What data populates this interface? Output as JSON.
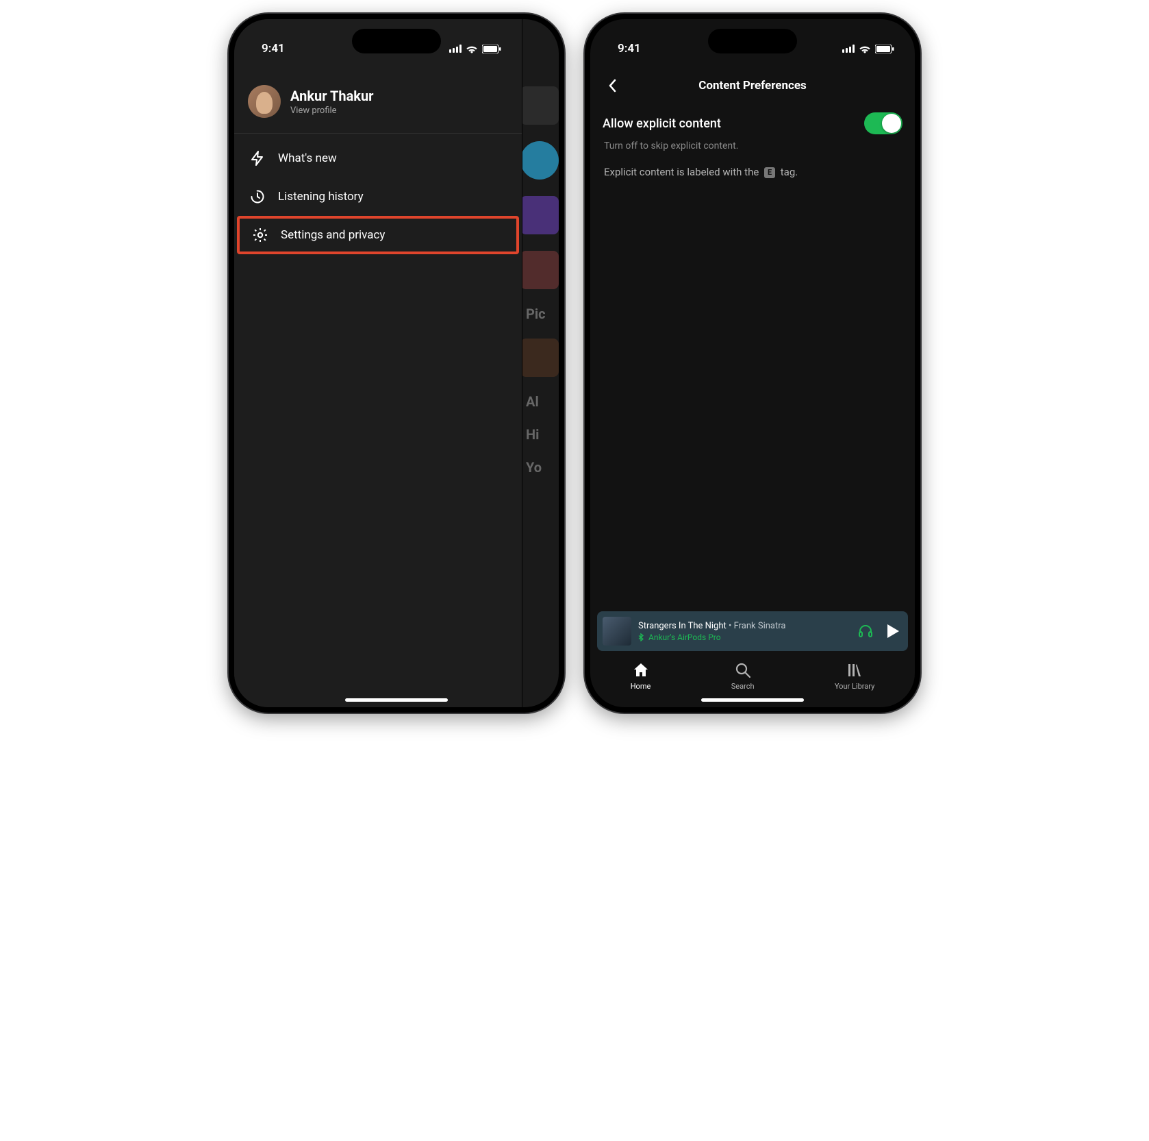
{
  "status": {
    "time": "9:41"
  },
  "left": {
    "user": {
      "name": "Ankur Thakur",
      "sub": "View profile"
    },
    "menu": {
      "whats_new": "What's new",
      "history": "Listening history",
      "settings": "Settings and privacy"
    },
    "bg_hints": {
      "pic": "Pic",
      "al": "Al",
      "hi": "Hi",
      "yo": "Yo"
    }
  },
  "right": {
    "title": "Content Preferences",
    "explicit": {
      "label": "Allow explicit content",
      "on": true,
      "desc": "Turn off to skip explicit content.",
      "tag_prefix": "Explicit content is labeled with the",
      "tag_suffix": "tag.",
      "tag_letter": "E"
    },
    "now_playing": {
      "title": "Strangers In The Night",
      "separator": " • ",
      "artist": "Frank Sinatra",
      "device": "Ankur's AirPods Pro"
    },
    "tabs": {
      "home": "Home",
      "search": "Search",
      "library": "Your Library"
    }
  }
}
